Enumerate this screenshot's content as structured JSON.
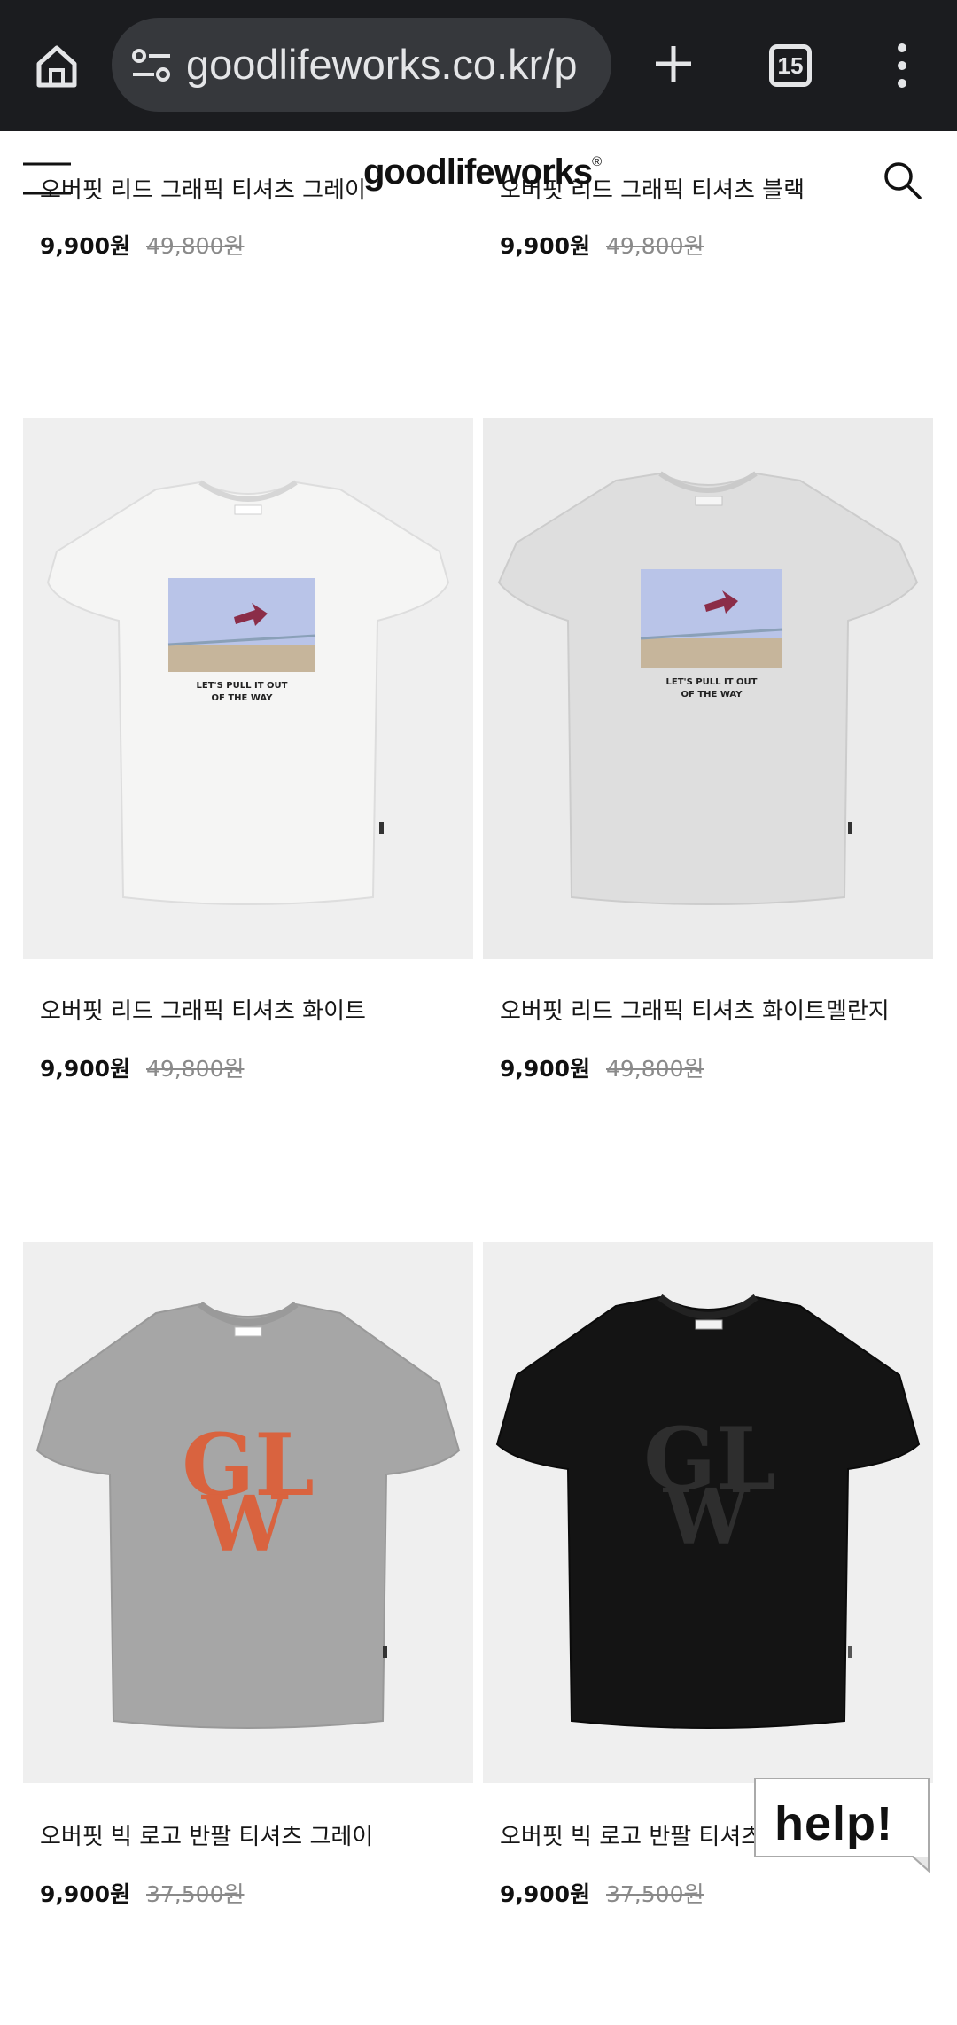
{
  "browser": {
    "url": "goodlifeworks.co.kr/p",
    "tab_count": "15",
    "icons": [
      "home-icon",
      "site-settings-icon",
      "new-tab-icon",
      "tab-switcher-icon",
      "more-menu-icon"
    ]
  },
  "header": {
    "logo": "goodlifeworks",
    "registered": "®",
    "icons": [
      "menu-icon",
      "search-icon"
    ]
  },
  "products": [
    {
      "name": "오버핏 리드 그래픽 티셔츠 그레이",
      "price": "9,900원",
      "original_price": "49,800원"
    },
    {
      "name": "오버핏 리드 그래픽 티셔츠 블랙",
      "price": "9,900원",
      "original_price": "49,800원"
    },
    {
      "name": "오버핏 리드 그래픽 티셔츠 화이트",
      "price": "9,900원",
      "original_price": "49,800원",
      "print_text": [
        "LET'S PULL IT OUT",
        "OF THE WAY"
      ],
      "shirt_color": "#f3f3f2"
    },
    {
      "name": "오버핏 리드 그래픽 티셔츠 화이트멜란지",
      "price": "9,900원",
      "original_price": "49,800원",
      "print_text": [
        "LET'S PULL IT OUT",
        "OF THE WAY"
      ],
      "shirt_color": "#dcdcdc"
    },
    {
      "name": "오버핏 빅 로고 반팔 티셔츠 그레이",
      "price": "9,900원",
      "original_price": "37,500원",
      "print_text": [
        "GL",
        "W"
      ],
      "shirt_color": "#a9a9a9",
      "logo_color": "#d9633f"
    },
    {
      "name": "오버핏 빅 로고 반팔 티셔츠",
      "price": "9,900원",
      "original_price": "37,500원",
      "print_text": [
        "GL",
        "W"
      ],
      "shirt_color": "#121212",
      "logo_color": "#2e2e2e"
    }
  ],
  "help_button": {
    "label": "help!"
  }
}
